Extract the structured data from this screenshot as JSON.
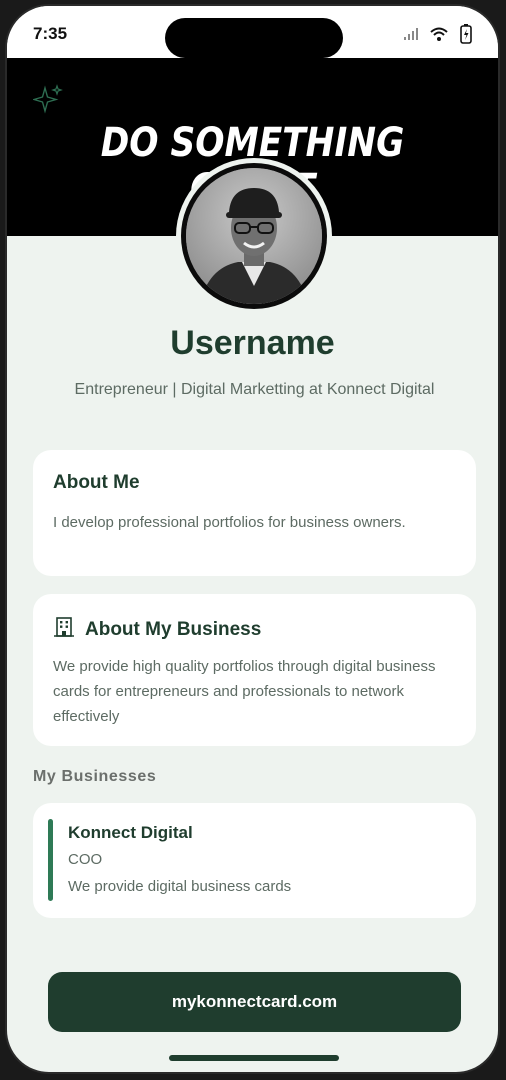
{
  "status_bar": {
    "time": "7:35",
    "icons": [
      "signal-icon",
      "wifi-icon",
      "battery-icon"
    ]
  },
  "banner": {
    "title": "DO SOMETHING GREAT",
    "icon": "sparkle-icon"
  },
  "profile": {
    "username": "Username",
    "tagline": "Entrepreneur | Digital Marketting at Konnect Digital"
  },
  "about_me": {
    "title": "About Me",
    "text": "I develop professional portfolios for business owners."
  },
  "about_business": {
    "icon": "building-icon",
    "title": "About My Business",
    "text": "We provide high quality portfolios through digital business cards for entrepreneurs and professionals to network effectively"
  },
  "businesses": {
    "section_label": "My Businesses",
    "items": [
      {
        "name": "Konnect Digital",
        "role": "COO",
        "description": "We provide digital business cards"
      }
    ]
  },
  "footer": {
    "url_button": "mykonnectcard.com"
  },
  "colors": {
    "accent": "#1f3d2e",
    "accent_bar": "#2e7a56",
    "background": "#eef3ef",
    "banner": "#000000"
  }
}
